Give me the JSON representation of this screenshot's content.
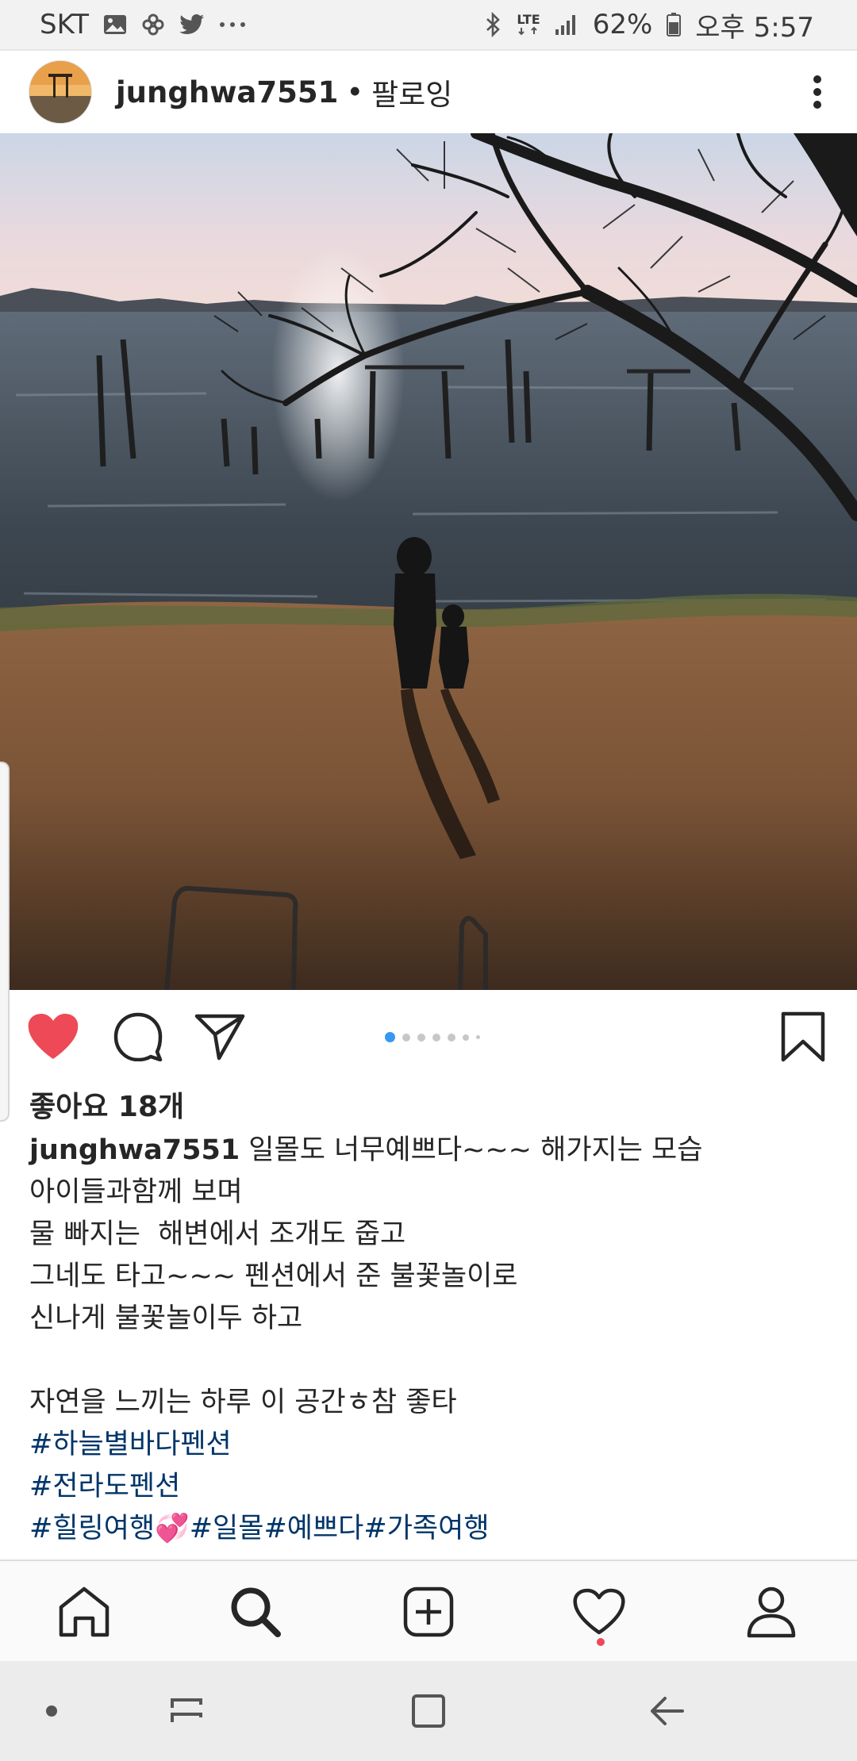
{
  "status_bar": {
    "carrier": "SKT",
    "left_icons": [
      "gallery-icon",
      "pinwheel-icon",
      "twitter-icon",
      "more-dots-icon"
    ],
    "network": "LTE",
    "battery_percent": "62%",
    "time": "오후 5:57"
  },
  "post": {
    "username": "junghwa7551",
    "separator": "•",
    "follow_status": "팔로잉",
    "carousel": {
      "total": 7,
      "current": 1
    },
    "likes": "좋아요 18개",
    "caption": {
      "username": "junghwa7551",
      "first_line": " 일몰도 너무예쁘다~~~ 해가지는 모습",
      "lines": [
        "아이들과함께 보며",
        "물 빠지는  해변에서 조개도 줍고",
        "그네도 타고~~~ 펜션에서 준 불꽃놀이로",
        "신나게 불꽃놀이두 하고",
        "",
        "자연을 느끼는 하루 이 공간ㅎ참 좋타"
      ],
      "hashtag_lines": [
        "#하늘별바다펜션",
        "#전라도펜션"
      ],
      "last_line": {
        "tag1": "#힐링여행",
        "emoji": "💞",
        "tag2": "#일몰#예쁘다#가족여행"
      }
    }
  },
  "colors": {
    "like_red": "#ed4956",
    "link_blue": "#003569",
    "dot_active": "#3897f0"
  },
  "bottom_nav": [
    "home-icon",
    "search-icon",
    "add-post-icon",
    "activity-heart-icon",
    "profile-icon"
  ],
  "system_nav": [
    "dot-button",
    "recent-apps-button",
    "home-button",
    "back-button"
  ]
}
